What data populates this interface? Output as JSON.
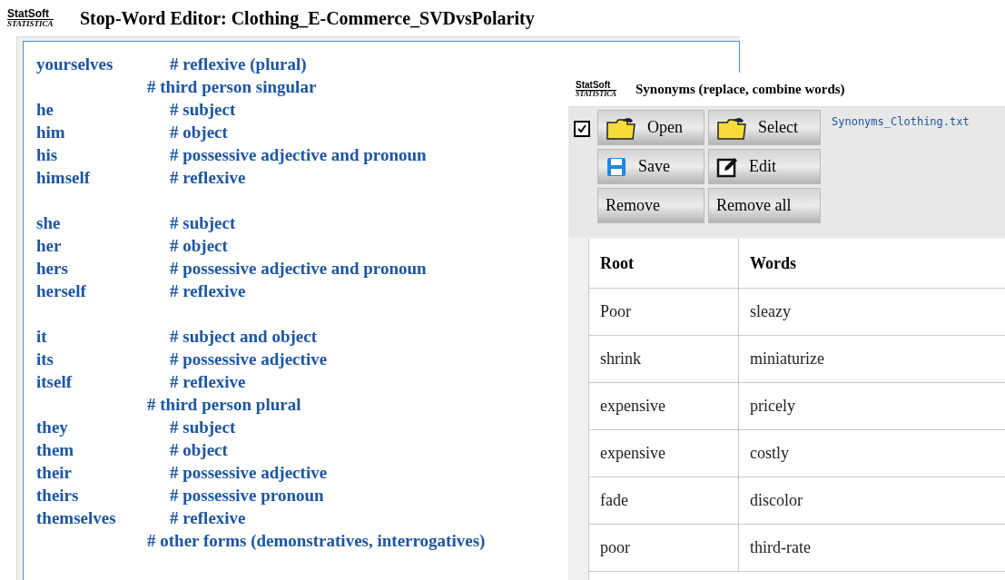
{
  "window": {
    "logo": {
      "top": "StatSoft",
      "bottom": "STATISTICA"
    },
    "title": "Stop-Word Editor: Clothing_E-Commerce_SVDvsPolarity"
  },
  "editor": {
    "lines": [
      {
        "kind": "entry",
        "word": "yourselves",
        "comment": "# reflexive (plural)"
      },
      {
        "kind": "heading",
        "comment": "# third person singular"
      },
      {
        "kind": "entry",
        "word": "he",
        "comment": "# subject"
      },
      {
        "kind": "entry",
        "word": "him",
        "comment": "# object"
      },
      {
        "kind": "entry",
        "word": "his",
        "comment": "# possessive adjective and pronoun"
      },
      {
        "kind": "entry",
        "word": "himself",
        "comment": "# reflexive"
      },
      {
        "kind": "blank"
      },
      {
        "kind": "entry",
        "word": "she",
        "comment": "# subject"
      },
      {
        "kind": "entry",
        "word": "her",
        "comment": "# object"
      },
      {
        "kind": "entry",
        "word": "hers",
        "comment": "# possessive adjective and pronoun"
      },
      {
        "kind": "entry",
        "word": "herself",
        "comment": "# reflexive"
      },
      {
        "kind": "blank"
      },
      {
        "kind": "entry",
        "word": "it",
        "comment": "# subject and object"
      },
      {
        "kind": "entry",
        "word": "its",
        "comment": "# possessive adjective"
      },
      {
        "kind": "entry",
        "word": "itself",
        "comment": "# reflexive"
      },
      {
        "kind": "heading",
        "comment": "# third person plural"
      },
      {
        "kind": "entry",
        "word": "they",
        "comment": "# subject"
      },
      {
        "kind": "entry",
        "word": "them",
        "comment": "# object"
      },
      {
        "kind": "entry",
        "word": "their",
        "comment": "# possessive adjective"
      },
      {
        "kind": "entry",
        "word": "theirs",
        "comment": "# possessive pronoun"
      },
      {
        "kind": "entry",
        "word": "themselves",
        "comment": "# reflexive"
      },
      {
        "kind": "heading",
        "comment": "# other forms (demonstratives, interrogatives)"
      }
    ]
  },
  "synonyms": {
    "logo": {
      "top": "StatSoft",
      "bottom": "STATISTICA"
    },
    "title": "Synonyms (replace, combine words)",
    "checked": true,
    "buttons": [
      {
        "label": "Open",
        "kind": "folder"
      },
      {
        "label": "Select",
        "kind": "folder"
      },
      {
        "label": "Save",
        "kind": "disk"
      },
      {
        "label": "Edit",
        "kind": "pencil"
      },
      {
        "label": "Remove",
        "kind": "text"
      },
      {
        "label": "Remove all",
        "kind": "text"
      }
    ],
    "file": "Synonyms_Clothing.txt",
    "table": {
      "columns": [
        "Root",
        "Words"
      ],
      "rows": [
        [
          "Poor",
          "sleazy"
        ],
        [
          "shrink",
          "miniaturize"
        ],
        [
          "expensive",
          "pricely"
        ],
        [
          "expensive",
          "costly"
        ],
        [
          "fade",
          "discolor"
        ],
        [
          "poor",
          "third-rate"
        ]
      ]
    }
  }
}
